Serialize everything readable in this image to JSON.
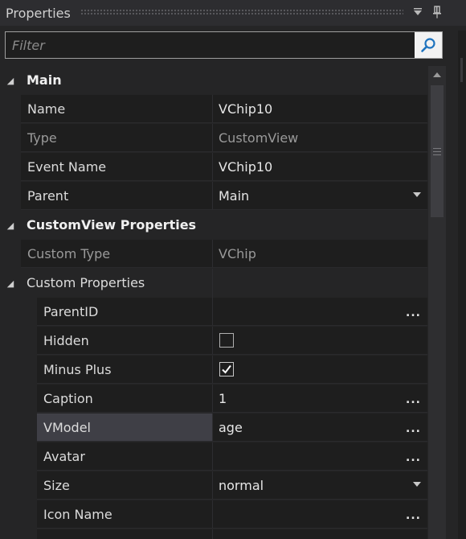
{
  "panel": {
    "title": "Properties",
    "filter_placeholder": "Filter",
    "icons": {
      "dropdown": "chevron-down-icon",
      "pin": "pin-icon",
      "search": "search-icon"
    }
  },
  "categories": [
    {
      "label": "Main",
      "rows": [
        {
          "name": "Name",
          "value": "VChip10"
        },
        {
          "name": "Type",
          "value": "CustomView",
          "readonly": true
        },
        {
          "name": "Event Name",
          "value": "VChip10"
        },
        {
          "name": "Parent",
          "value": "Main",
          "control": "dropdown"
        }
      ]
    },
    {
      "label": "CustomView Properties",
      "rows": [
        {
          "name": "Custom Type",
          "value": "VChip",
          "readonly": true
        }
      ],
      "subgroup": {
        "label": "Custom Properties",
        "rows": [
          {
            "name": "ParentID",
            "value": "",
            "control": "ellipsis"
          },
          {
            "name": "Hidden",
            "value": "",
            "control": "checkbox",
            "checked": false
          },
          {
            "name": "Minus Plus",
            "value": "",
            "control": "checkbox",
            "checked": true
          },
          {
            "name": "Caption",
            "value": "1",
            "control": "ellipsis"
          },
          {
            "name": "VModel",
            "value": "age",
            "control": "ellipsis",
            "selected": true
          },
          {
            "name": "Avatar",
            "value": "",
            "control": "ellipsis"
          },
          {
            "name": "Size",
            "value": "normal",
            "control": "dropdown"
          },
          {
            "name": "Icon Name",
            "value": "",
            "control": "ellipsis"
          }
        ]
      }
    }
  ],
  "colors": {
    "background": "#252526",
    "cell": "#1e1e1e",
    "selected": "#3f3f46",
    "text": "#dcdcdc",
    "dim_text": "#9a9a9a"
  }
}
